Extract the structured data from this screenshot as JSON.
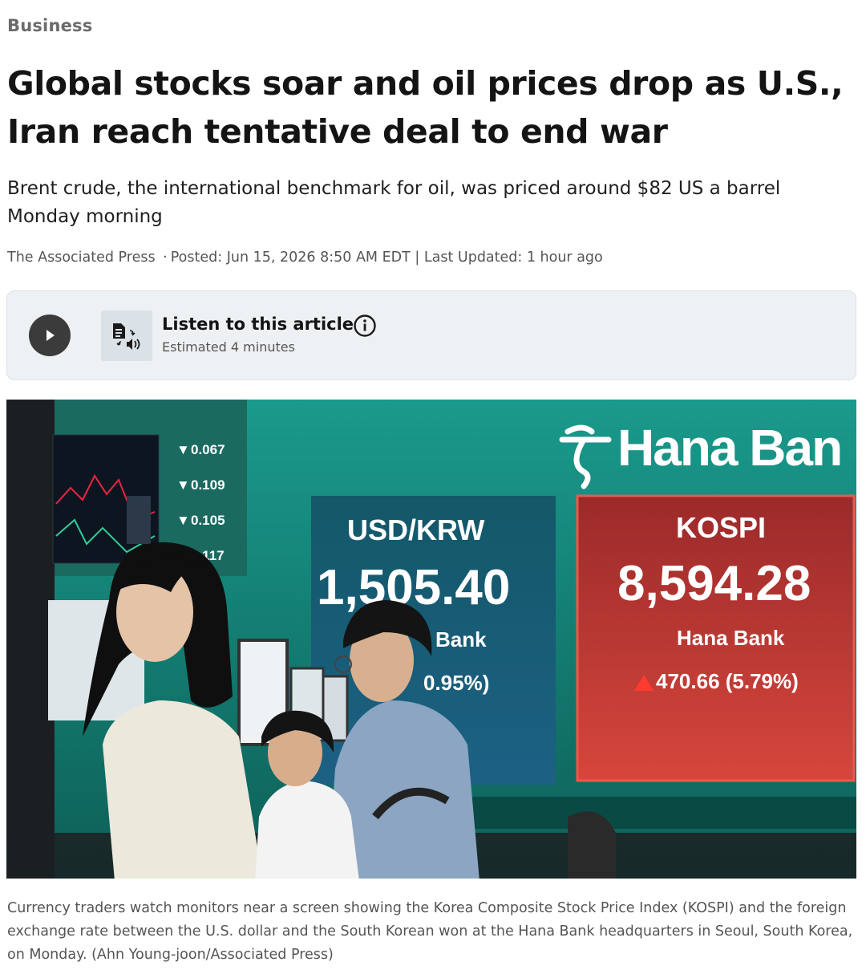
{
  "article": {
    "section": "Business",
    "headline": "Global stocks soar and oil prices drop as U.S., Iran reach tentative deal to end war",
    "subheadline": "Brent crude, the international benchmark for oil, was priced around $82 US a barrel Monday morning",
    "byline": {
      "source": "The Associated Press",
      "separator": "·",
      "posted": "Posted: Jun 15, 2026 8:50 AM EDT",
      "divider": "|",
      "updated": "Last Updated: 1 hour ago"
    }
  },
  "listen": {
    "title": "Listen to this article",
    "subtitle": "Estimated 4 minutes",
    "icons": [
      "play-icon",
      "text-to-speech-icon",
      "info-icon"
    ]
  },
  "photo": {
    "screen": {
      "brand": "Hana Ban",
      "usd_label": "USD/KRW",
      "usd_value": "1,505.40",
      "usd_bank": "Bank",
      "usd_change": "0.95%)",
      "kospi_label": "KOSPI",
      "kospi_value": "8,594.28",
      "kospi_bank": "Hana Bank",
      "kospi_change": "470.66 (5.79%)",
      "ticks": [
        "0.067",
        "0.109",
        "0.105",
        "0.117"
      ]
    },
    "caption": "Currency traders watch monitors near a screen showing the Korea Composite Stock Price Index (KOSPI) and the foreign exchange rate between the U.S. dollar and the South Korean won at the Hana Bank headquarters in Seoul, South Korea, on Monday. (Ahn Young-joon/Associated Press)"
  },
  "colors": {
    "screen_teal": "#1f8f84",
    "kospi_red": "#b5312b",
    "play_button": "#3b3b3b",
    "listen_bg": "#eef1f3"
  }
}
